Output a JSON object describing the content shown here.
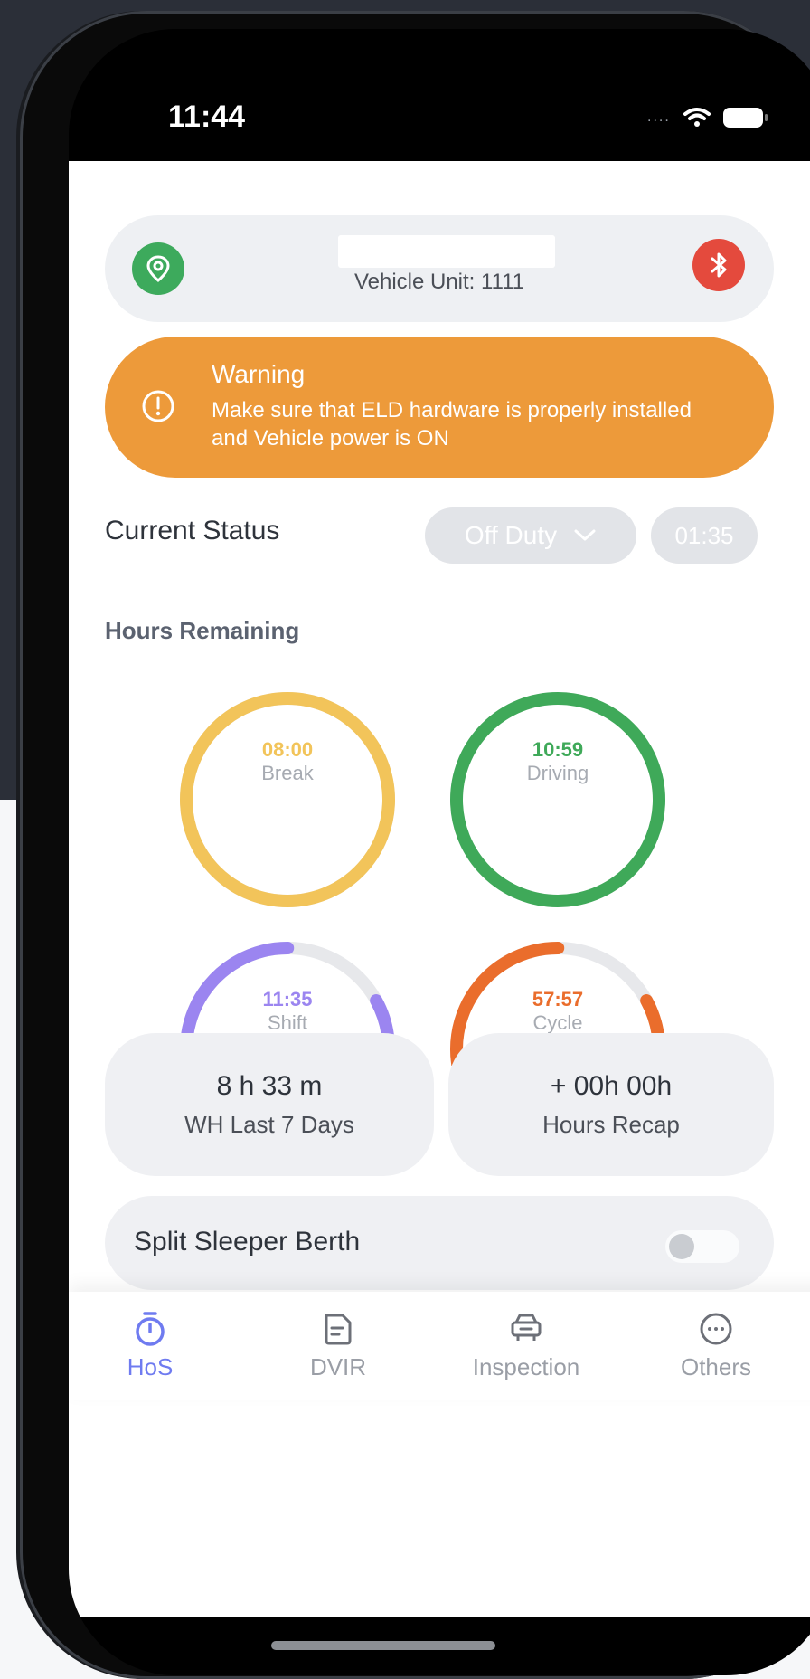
{
  "status_bar": {
    "time": "11:44",
    "signal_dots": "....",
    "icons": [
      "wifi-icon",
      "battery-icon"
    ]
  },
  "vehicle": {
    "unit_label": "Vehicle Unit: 1111",
    "location_icon": "location-pin-icon",
    "bluetooth_icon": "bluetooth-icon"
  },
  "warning": {
    "title": "Warning",
    "message": "Make sure that ELD hardware is properly installed and Vehicle power is ON",
    "icon": "alert-circle-icon"
  },
  "current_status": {
    "label": "Current Status",
    "value": "Off Duty",
    "time": "01:35"
  },
  "hours_remaining": {
    "title": "Hours Remaining",
    "gauges": [
      {
        "name": "Break",
        "value": "08:00",
        "color": "#f2c45a",
        "progress": 1.0
      },
      {
        "name": "Driving",
        "value": "10:59",
        "color": "#3fa959",
        "progress": 1.0
      },
      {
        "name": "Shift",
        "value": "11:35",
        "color": "#9b85f0",
        "progress": 0.83
      },
      {
        "name": "Cycle",
        "value": "57:57",
        "color": "#ea6d2c",
        "progress": 0.83
      }
    ]
  },
  "stats": {
    "wh_last_7_days": {
      "value": "8 h 33 m",
      "label": "WH Last 7 Days"
    },
    "hours_recap": {
      "value": "+ 00h 00h",
      "label": "Hours Recap"
    }
  },
  "split_sleeper": {
    "label": "Split Sleeper Berth",
    "enabled": false
  },
  "tabs": [
    {
      "label": "HoS",
      "icon": "stopwatch-icon",
      "active": true
    },
    {
      "label": "DVIR",
      "icon": "document-icon",
      "active": false
    },
    {
      "label": "Inspection",
      "icon": "car-inspection-icon",
      "active": false
    },
    {
      "label": "Others",
      "icon": "more-dots-icon",
      "active": false
    }
  ],
  "colors": {
    "accent": "#6f7bf0",
    "warning": "#ed9a3a",
    "location": "#3daa5c",
    "bluetooth": "#e44a3d"
  }
}
